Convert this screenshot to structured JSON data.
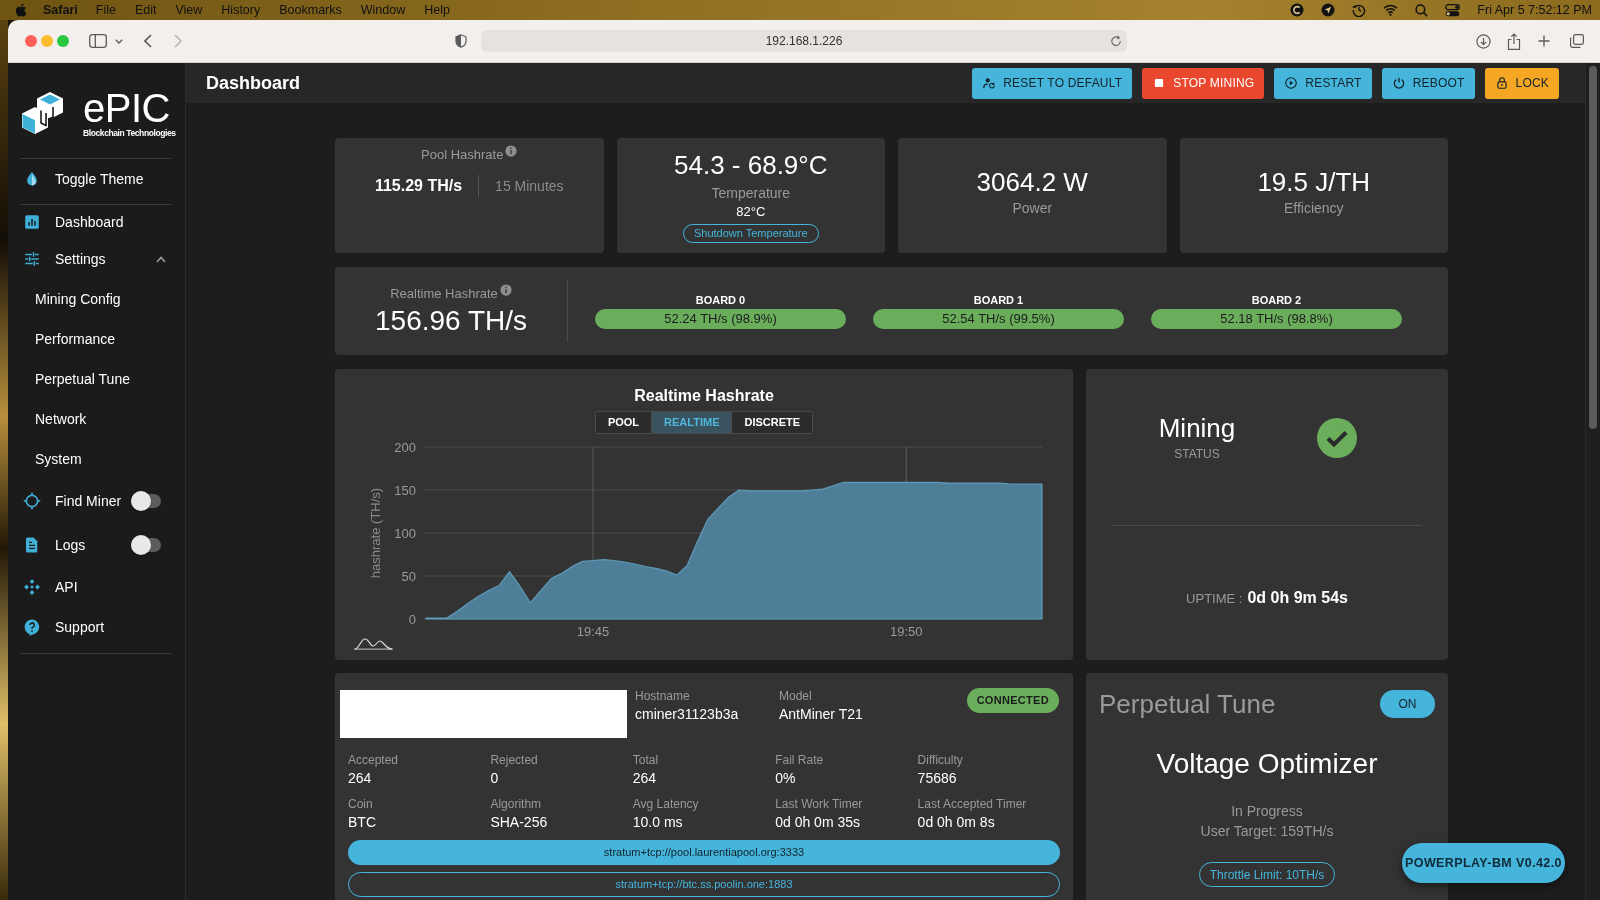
{
  "menu_bar": {
    "app": "Safari",
    "items": [
      "File",
      "Edit",
      "View",
      "History",
      "Bookmarks",
      "Window",
      "Help"
    ],
    "clock": "Fri Apr 5 7:52:12 PM"
  },
  "browser": {
    "url": "192.168.1.226"
  },
  "sidebar": {
    "logo": {
      "wordmark": "ePIC",
      "tagline": "Blockchain Technologies"
    },
    "items": [
      {
        "kind": "link",
        "label": "Toggle Theme"
      },
      {
        "kind": "divider"
      },
      {
        "kind": "link",
        "label": "Dashboard"
      },
      {
        "kind": "group",
        "label": "Settings",
        "expanded": true,
        "children": [
          {
            "label": "Mining Config"
          },
          {
            "label": "Performance"
          },
          {
            "label": "Perpetual Tune"
          },
          {
            "label": "Network"
          },
          {
            "label": "System"
          }
        ]
      },
      {
        "kind": "toggle",
        "label": "Find Miner",
        "on": false
      },
      {
        "kind": "toggle",
        "label": "Logs",
        "on": false
      },
      {
        "kind": "link",
        "label": "API"
      },
      {
        "kind": "link",
        "label": "Support"
      },
      {
        "kind": "divider"
      }
    ]
  },
  "header": {
    "title": "Dashboard",
    "buttons": [
      {
        "label": "RESET TO DEFAULT",
        "color": "#45b5dc"
      },
      {
        "label": "STOP MINING",
        "color": "#e9472e"
      },
      {
        "label": "RESTART",
        "color": "#45b5dc"
      },
      {
        "label": "REBOOT",
        "color": "#45b5dc"
      },
      {
        "label": "LOCK",
        "color": "#f5a623"
      }
    ]
  },
  "pool_hashrate": {
    "label": "Pool Hashrate",
    "value": "115.29 TH/s",
    "window": "15 Minutes"
  },
  "temperature": {
    "range": "54.3 - 68.9°C",
    "label": "Temperature",
    "shutdown_value": "82°C",
    "shutdown_label": "Shutdown Temperature"
  },
  "power": {
    "value": "3064.2 W",
    "label": "Power"
  },
  "efficiency": {
    "value": "19.5 J/TH",
    "label": "Efficiency"
  },
  "realtime_hashrate": {
    "label": "Realtime Hashrate",
    "value": "156.96 TH/s",
    "boards": [
      {
        "name": "BOARD 0",
        "value": "52.24 TH/s (98.9%)"
      },
      {
        "name": "BOARD 1",
        "value": "52.54 TH/s (99.5%)"
      },
      {
        "name": "BOARD 2",
        "value": "52.18 TH/s (98.8%)"
      }
    ]
  },
  "chart": {
    "modes": [
      {
        "label": "POOL",
        "selected": false
      },
      {
        "label": "REALTIME",
        "selected": true
      },
      {
        "label": "DISCRETE",
        "selected": false
      }
    ],
    "chart_data": {
      "type": "area",
      "title": "Realtime Hashrate",
      "ylabel": "hashrate (TH/s)",
      "categories": [
        null,
        null,
        null,
        null,
        null,
        null,
        null,
        null,
        null,
        null,
        null,
        null,
        null,
        null,
        null,
        null,
        "19:45",
        null,
        null,
        null,
        null,
        null,
        null,
        null,
        null,
        null,
        null,
        null,
        null,
        null,
        null,
        null,
        null,
        null,
        null,
        null,
        null,
        null,
        null,
        null,
        null,
        null,
        null,
        null,
        null,
        null,
        "19:50",
        null,
        null,
        null,
        null,
        null,
        null,
        null,
        null,
        null,
        null,
        null,
        null,
        null
      ],
      "values": [
        1,
        1,
        1,
        9,
        18,
        26,
        33,
        39,
        55,
        38,
        19,
        33,
        47,
        53,
        61,
        67,
        68,
        69,
        68,
        66,
        64,
        61,
        59,
        56,
        51,
        62,
        90,
        116,
        129,
        142,
        150,
        149,
        149,
        149,
        149,
        149,
        149,
        150,
        151,
        155,
        159,
        159,
        159,
        159,
        159,
        159,
        159,
        159,
        159,
        159,
        158,
        158,
        158,
        158,
        158,
        158,
        157,
        157,
        157,
        157
      ],
      "ylim": [
        0,
        200
      ],
      "yticks": [
        0,
        50,
        100,
        150,
        200
      ],
      "grid": true
    }
  },
  "status": {
    "state": "Mining",
    "label": "STATUS",
    "uptime_label": "UPTIME :",
    "uptime": "0d 0h 9m 54s"
  },
  "pool": {
    "hostname_label": "Hostname",
    "hostname": "cminer31123b3a",
    "model_label": "Model",
    "model": "AntMiner T21",
    "status": "CONNECTED",
    "stats": [
      {
        "label": "Accepted",
        "value": "264"
      },
      {
        "label": "Rejected",
        "value": "0"
      },
      {
        "label": "Total",
        "value": "264"
      },
      {
        "label": "Fail Rate",
        "value": "0%"
      },
      {
        "label": "Difficulty",
        "value": "75686"
      },
      {
        "label": "Coin",
        "value": "BTC"
      },
      {
        "label": "Algorithm",
        "value": "SHA-256"
      },
      {
        "label": "Avg Latency",
        "value": "10.0 ms"
      },
      {
        "label": "Last Work Timer",
        "value": "0d 0h 0m 35s"
      },
      {
        "label": "Last Accepted Timer",
        "value": "0d 0h 0m 8s"
      }
    ],
    "urls": [
      {
        "url": "stratum+tcp://pool.laurentiapool.org:3333",
        "selected": true
      },
      {
        "url": "stratum+tcp://btc.ss.poolin.one:1883",
        "selected": false
      }
    ]
  },
  "perpetual_tune": {
    "title": "Perpetual Tune",
    "on": true,
    "toggle_label": "ON",
    "algorithm": "Voltage Optimizer",
    "status": "In Progress",
    "target": "User Target: 159TH/s",
    "throttle": "Throttle Limit: 10TH/s"
  },
  "version": "POWERPLAY-BM V0.42.0"
}
